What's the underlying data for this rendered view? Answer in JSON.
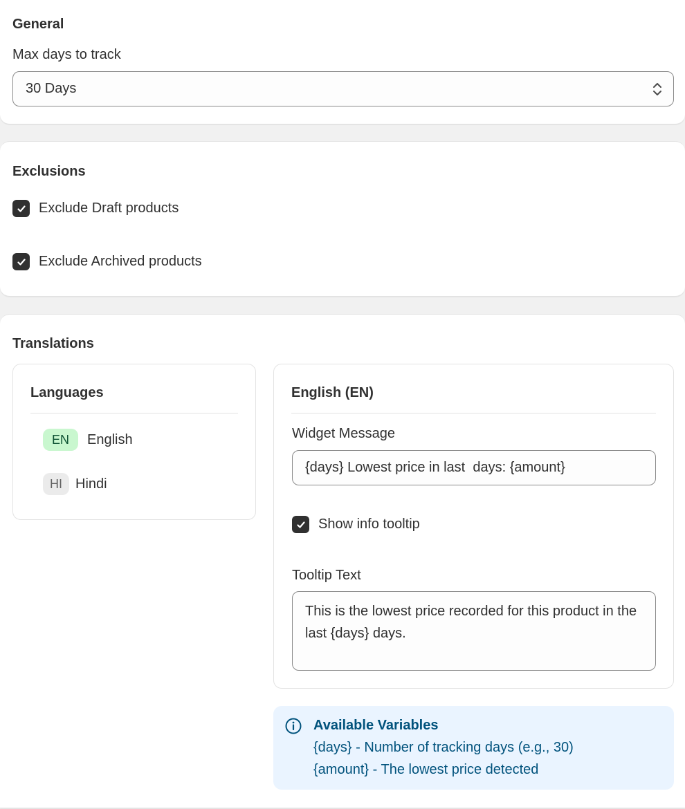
{
  "general": {
    "title": "General",
    "max_days_label": "Max days to track",
    "max_days_value": "30 Days"
  },
  "exclusions": {
    "title": "Exclusions",
    "exclude_draft": {
      "label": "Exclude Draft products",
      "checked": true
    },
    "exclude_archived": {
      "label": "Exclude Archived products",
      "checked": true
    }
  },
  "translations": {
    "title": "Translations",
    "languages": {
      "title": "Languages",
      "items": [
        {
          "code": "EN",
          "name": "English",
          "active": true
        },
        {
          "code": "HI",
          "name": "Hindi",
          "active": false
        }
      ]
    },
    "editor": {
      "title": "English (EN)",
      "widget_message_label": "Widget Message",
      "widget_message_value": "{days} Lowest price in last  days: {amount}",
      "show_tooltip": {
        "label": "Show info tooltip",
        "checked": true
      },
      "tooltip_text_label": "Tooltip Text",
      "tooltip_text_value": "This is the lowest price recorded for this product in the last {days} days."
    },
    "variables": {
      "title": "Available Variables",
      "lines": [
        "{days} - Number of tracking days (e.g., 30)",
        "{amount} - The lowest price detected"
      ],
      "icon": "info-circle-icon"
    }
  },
  "colors": {
    "checkbox": "#303030",
    "badge_active_bg": "#c9f7cf",
    "badge_inactive_bg": "#ebebeb",
    "info_bg": "#eaf4ff",
    "info_text": "#00527c"
  }
}
